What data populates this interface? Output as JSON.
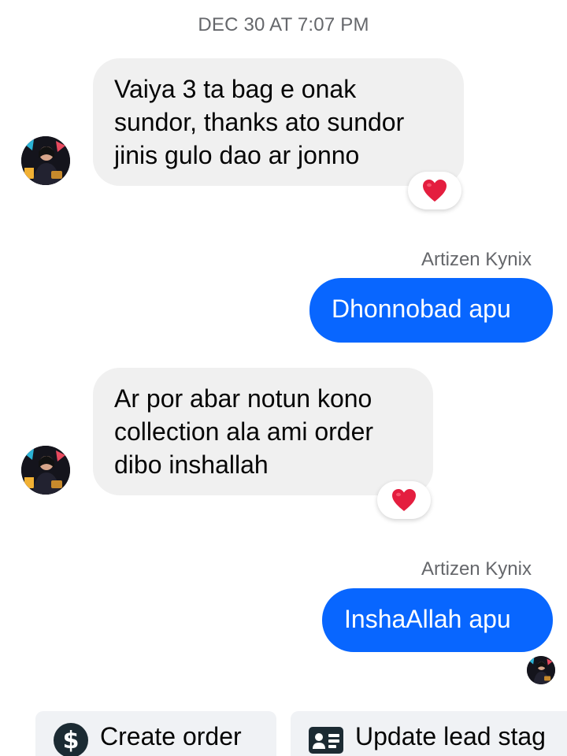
{
  "thread": {
    "timestamp": "DEC 30 AT 7:07 PM",
    "messages": [
      {
        "direction": "incoming",
        "text": "Vaiya 3 ta bag e onak sundor, thanks ato sundor jinis gulo dao ar jonno",
        "reaction": "heart-icon"
      },
      {
        "direction": "outgoing",
        "sender": "Artizen Kynix",
        "text": "Dhonnobad apu"
      },
      {
        "direction": "incoming",
        "text": "Ar por abar notun kono collection ala ami order dibo inshallah",
        "reaction": "heart-icon"
      },
      {
        "direction": "outgoing",
        "sender": "Artizen Kynix",
        "text": "InshaAllah apu"
      }
    ]
  },
  "actions": {
    "create_order": "Create order",
    "create_order_icon": "dollar-icon",
    "update_lead": "Update lead stag",
    "update_lead_icon": "contact-card-icon"
  },
  "colors": {
    "outgoing_bubble": "#0866ff",
    "incoming_bubble": "#f0f0f0",
    "reaction_heart": "#e41e3f",
    "meta_text": "#65676b"
  }
}
